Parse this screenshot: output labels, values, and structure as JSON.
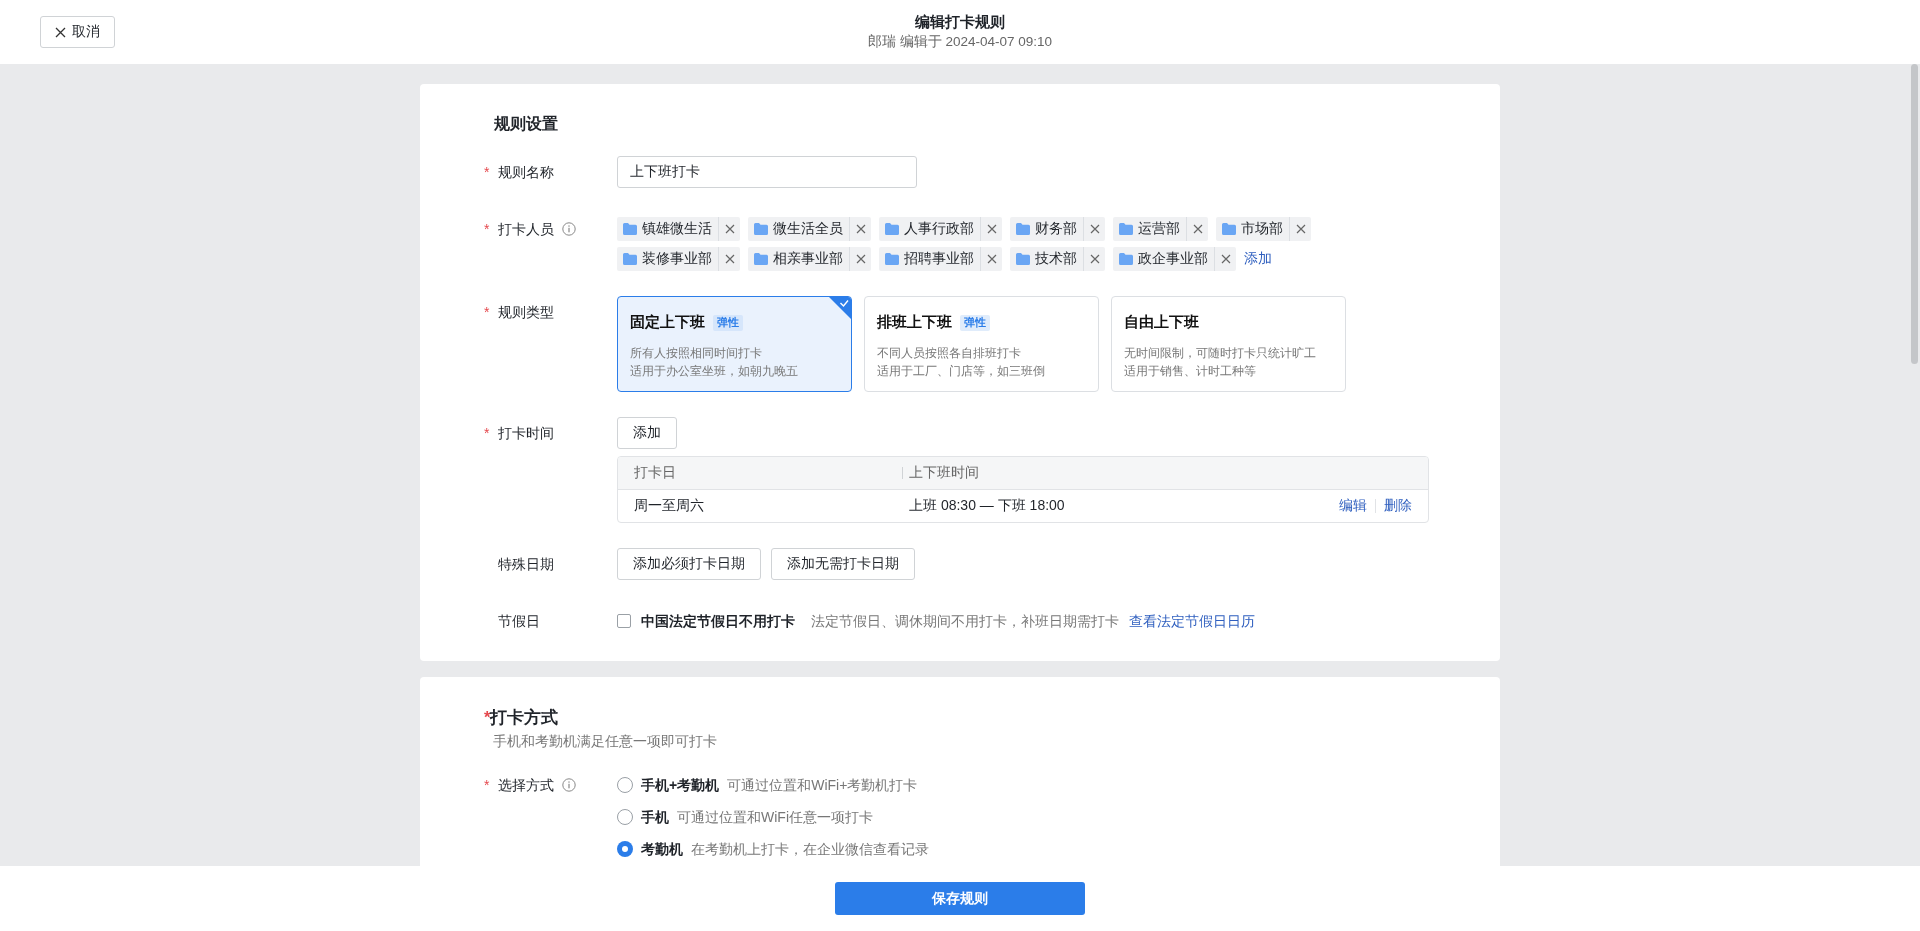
{
  "header": {
    "cancel_button": "取消",
    "title": "编辑打卡规则",
    "subtitle": "郎瑞 编辑于 2024-04-07 09:10"
  },
  "rule_settings": {
    "title": "规则设置",
    "name": {
      "label": "规则名称",
      "mark": "*",
      "value": "上下班打卡"
    },
    "members": {
      "label": "打卡人员",
      "mark": "*",
      "info_icon": true,
      "add_link": "添加",
      "tags": [
        {
          "name": "镇雄微生活"
        },
        {
          "name": "微生活全员"
        },
        {
          "name": "人事行政部"
        },
        {
          "name": "财务部"
        },
        {
          "name": "运营部"
        },
        {
          "name": "市场部"
        },
        {
          "name": "装修事业部"
        },
        {
          "name": "相亲事业部"
        },
        {
          "name": "招聘事业部"
        },
        {
          "name": "技术部"
        },
        {
          "name": "政企事业部"
        }
      ]
    },
    "rule_type": {
      "label": "规则类型",
      "mark": "*",
      "options": [
        {
          "title": "固定上下班",
          "badge": "弹性",
          "lines": [
            "所有人按照相同时间打卡",
            "适用于办公室坐班，如朝九晚五"
          ],
          "selected": true
        },
        {
          "title": "排班上下班",
          "badge": "弹性",
          "lines": [
            "不同人员按照各自排班打卡",
            "适用于工厂、门店等，如三班倒"
          ],
          "selected": false
        },
        {
          "title": "自由上下班",
          "lines": [
            "无时间限制，可随时打卡只统计旷工",
            "适用于销售、计时工种等"
          ],
          "selected": false
        }
      ]
    },
    "check_time": {
      "label": "打卡时间",
      "mark": "*",
      "add_button": "添加",
      "table": {
        "columns": [
          "打卡日",
          "上下班时间"
        ],
        "rows": [
          {
            "day": "周一至周六",
            "time": "上班 08:30 — 下班 18:00",
            "actions": [
              "编辑",
              "删除"
            ]
          }
        ]
      }
    },
    "special_dates": {
      "label": "特殊日期",
      "buttons": [
        "添加必须打卡日期",
        "添加无需打卡日期"
      ]
    },
    "holidays": {
      "label": "节假日",
      "checkbox": {
        "label": "中国法定节假日不用打卡",
        "checked": false
      },
      "hint": "法定节假日、调休期间不用打卡，补班日期需打卡",
      "link": "查看法定节假日日历"
    }
  },
  "check_method": {
    "title": "打卡方式",
    "mark": "*",
    "subtitle": "手机和考勤机满足任意一项即可打卡",
    "method": {
      "label": "选择方式",
      "mark": "*",
      "info_icon": true,
      "options": [
        {
          "label": "手机+考勤机",
          "desc": "可通过位置和WiFi+考勤机打卡",
          "selected": false
        },
        {
          "label": "手机",
          "desc": "可通过位置和WiFi任意一项打卡",
          "selected": false
        },
        {
          "label": "考勤机",
          "desc": "在考勤机上打卡，在企业微信查看记录",
          "selected": true
        }
      ]
    }
  },
  "footer": {
    "save_button": "保存规则"
  }
}
